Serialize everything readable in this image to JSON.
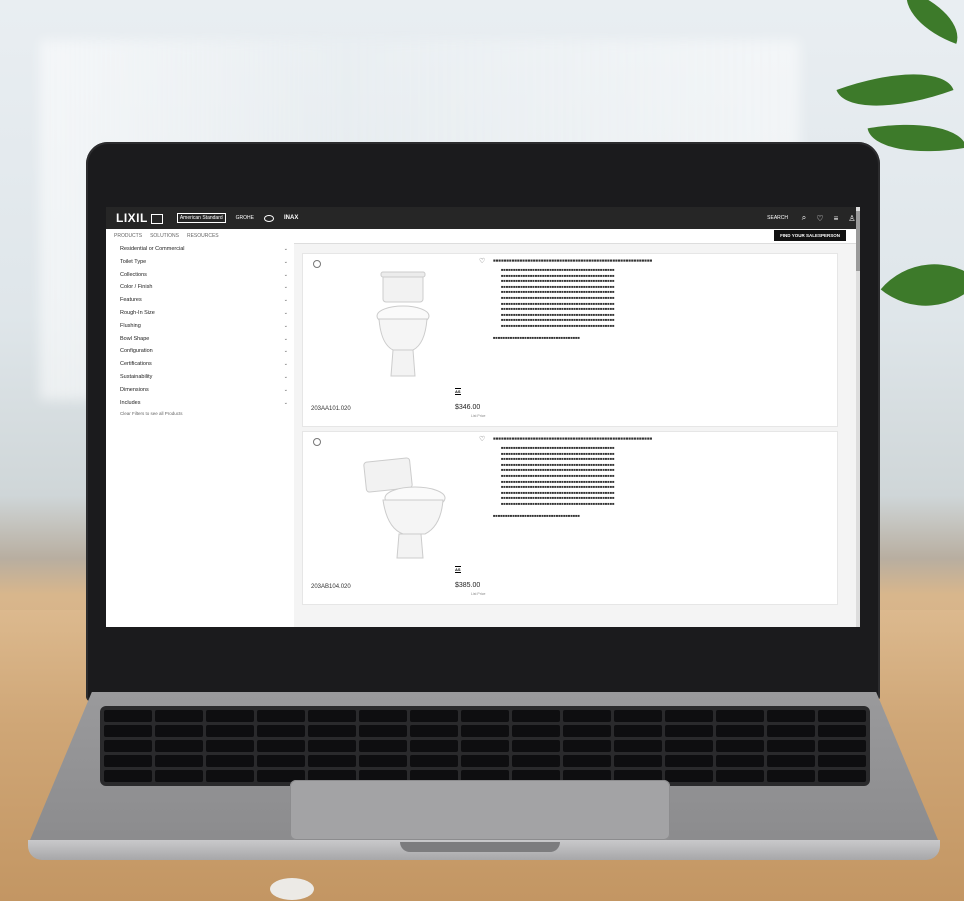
{
  "site": {
    "logo": "LIXIL",
    "brands": [
      "American Standard",
      "GROHE",
      "INAX"
    ],
    "search_label": "SEARCH"
  },
  "subnav": {
    "items": [
      "PRODUCTS",
      "SOLUTIONS",
      "RESOURCES"
    ],
    "find_button": "FIND YOUR SALESPERSON"
  },
  "filters": [
    "Residential or Commercial",
    "Toilet Type",
    "Collections",
    "Color / Finish",
    "Features",
    "Rough-In Size",
    "Flushing",
    "Bowl Shape",
    "Configuration",
    "Certifications",
    "Sustainability",
    "Dimensions",
    "Includes"
  ],
  "clear_filters": "Clear Filters to see all Products",
  "products": [
    {
      "sku": "203AA101.020",
      "price": "$346.00",
      "list_price": "List Price",
      "bullets_count": 11,
      "bullet_fill": "■■■■■■■■■■■■■■■■■■■■■■■■■■■■■■■■■■■■■■■■■■■■■■■"
    },
    {
      "sku": "203AB104.020",
      "price": "$385.00",
      "list_price": "List Price",
      "bullets_count": 11,
      "bullet_fill": "■■■■■■■■■■■■■■■■■■■■■■■■■■■■■■■■■■■■■■■■■■■■■■■"
    }
  ],
  "colors": {
    "topbar": "#262626",
    "page": "#f4f4f4",
    "button": "#111111"
  }
}
